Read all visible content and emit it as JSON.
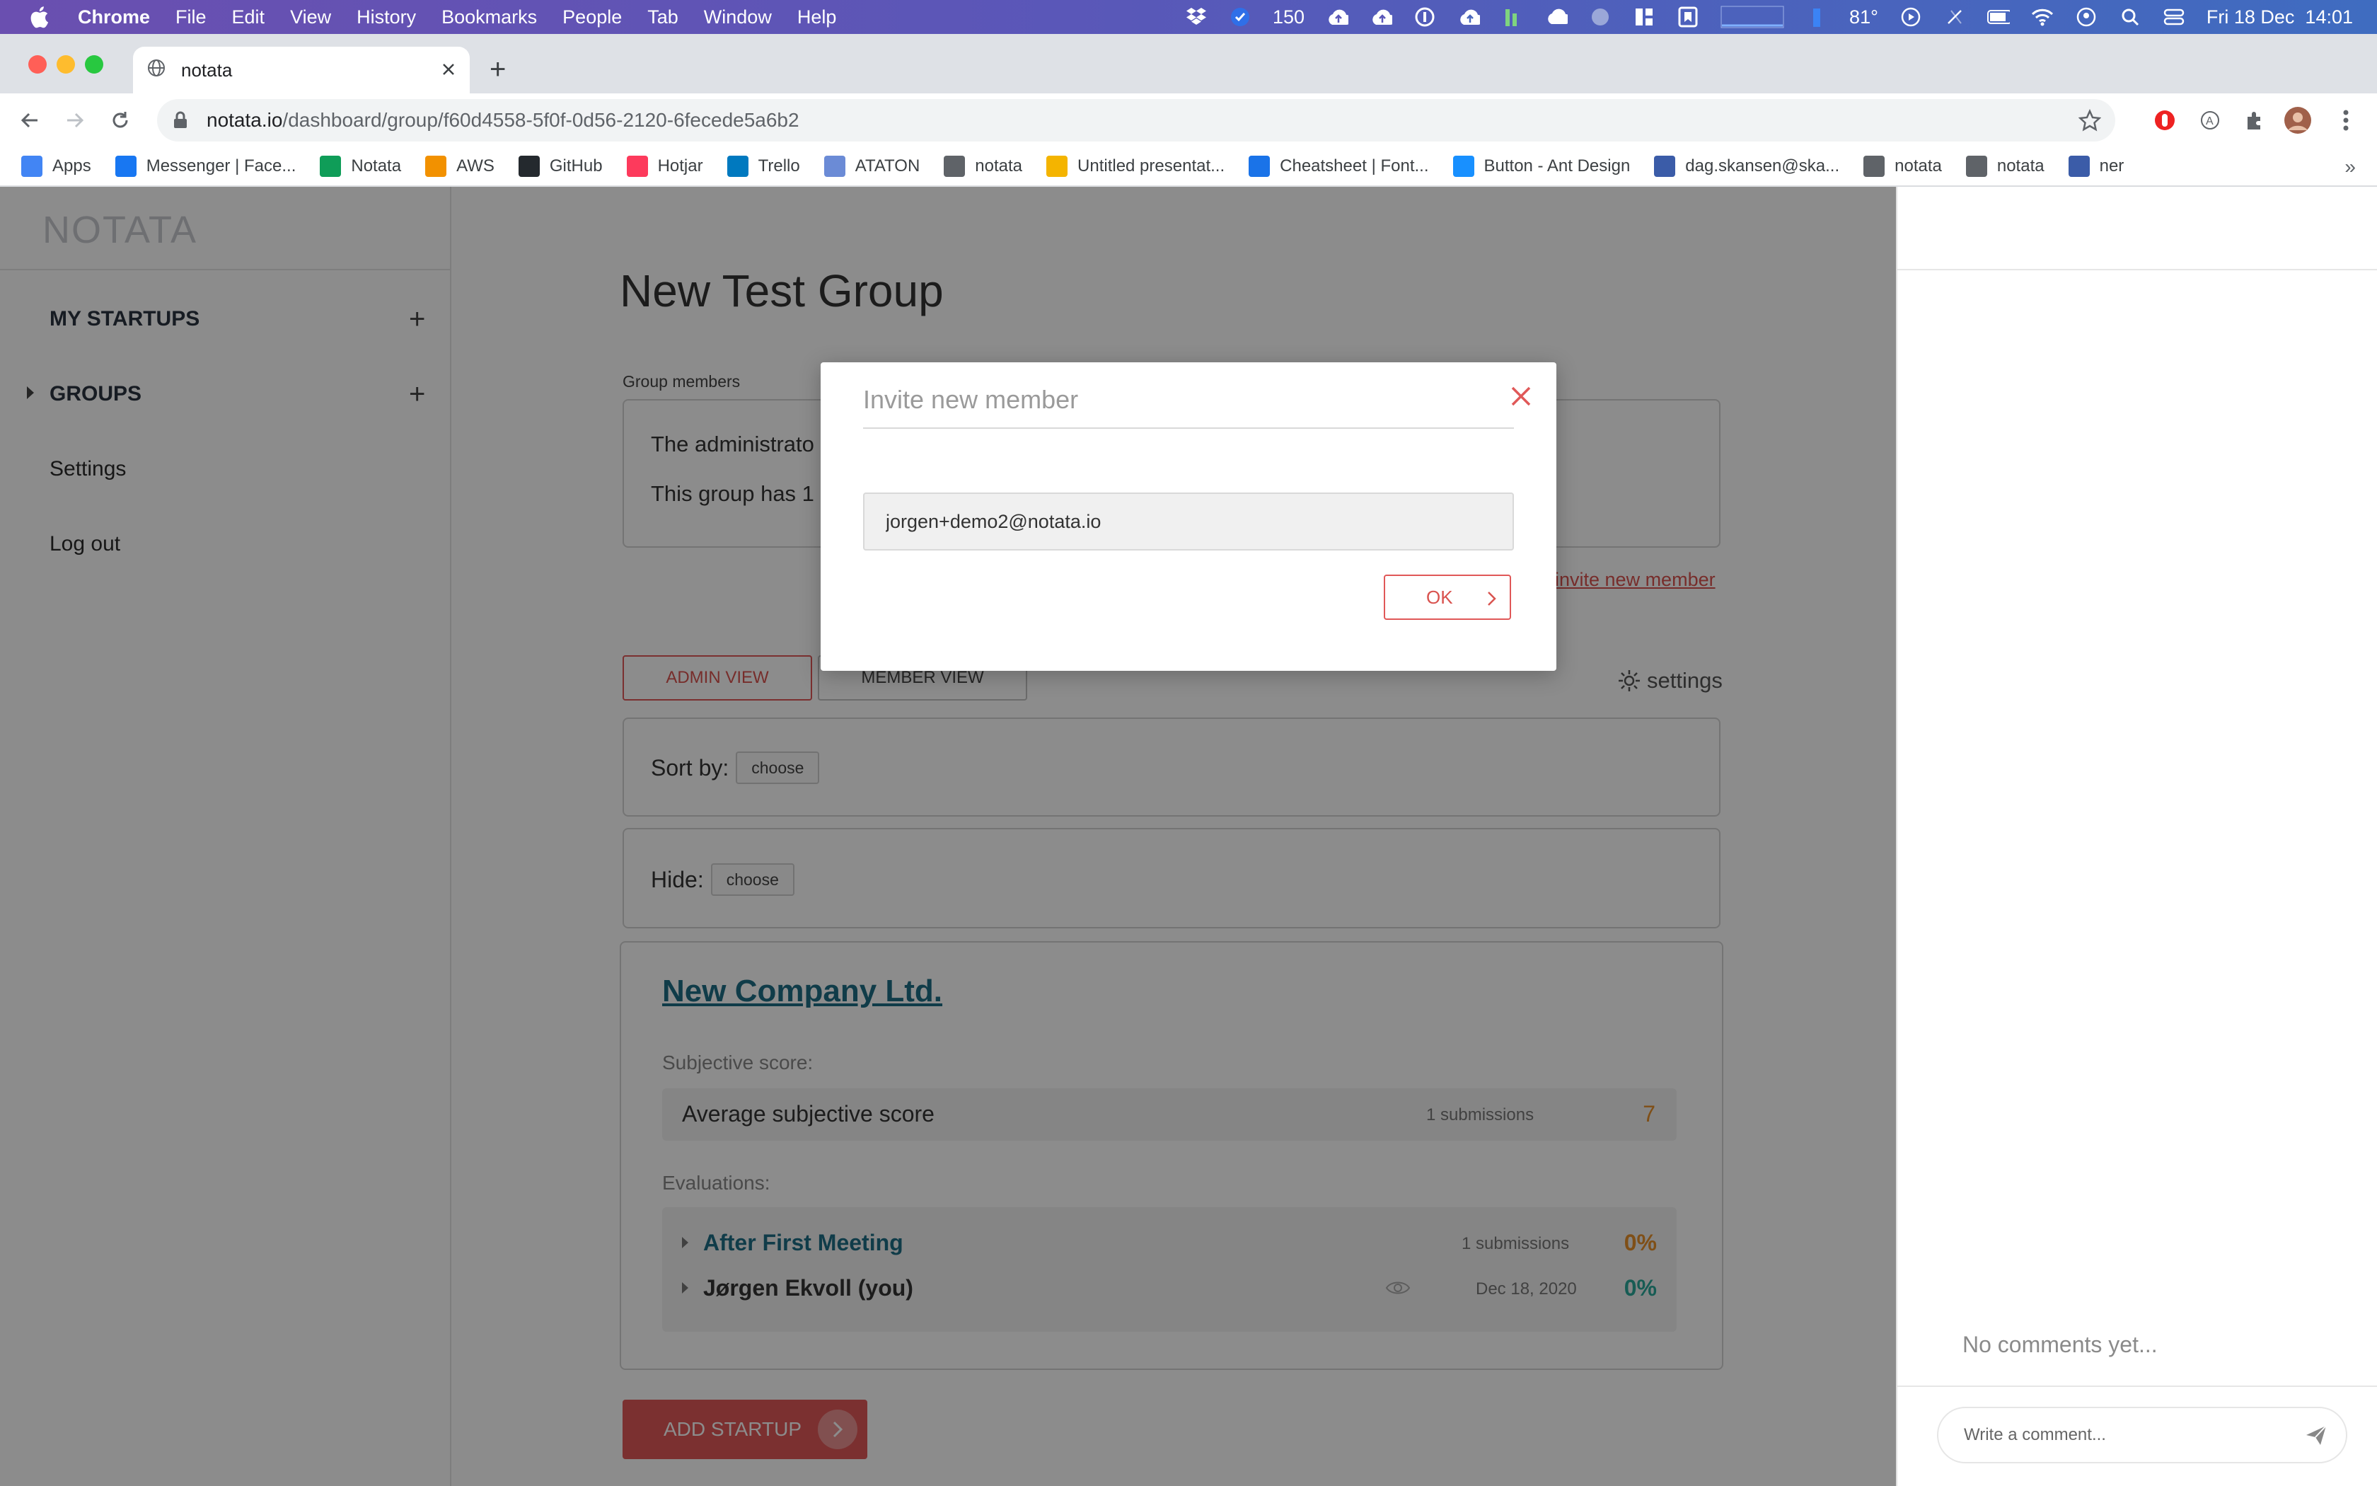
{
  "menubar": {
    "app_name": "Chrome",
    "menus": [
      "File",
      "Edit",
      "View",
      "History",
      "Bookmarks",
      "People",
      "Tab",
      "Window",
      "Help"
    ],
    "status_badge_count": "150",
    "temperature": "81°",
    "datetime": "Fri 18 Dec  14:01"
  },
  "browser": {
    "tab_title": "notata",
    "url_host": "notata.io",
    "url_path": "/dashboard/group/f60d4558-5f0f-0d56-2120-6fecede5a6b2",
    "bookmarks": [
      {
        "label": "Apps",
        "icon": "apps-grid-icon",
        "color": "#4285f4"
      },
      {
        "label": "Messenger | Face...",
        "icon": "facebook-icon",
        "color": "#1877f2"
      },
      {
        "label": "Notata",
        "icon": "drive-icon",
        "color": "#0f9d58"
      },
      {
        "label": "AWS",
        "icon": "aws-icon",
        "color": "#f29100"
      },
      {
        "label": "GitHub",
        "icon": "github-icon",
        "color": "#24292e"
      },
      {
        "label": "Hotjar",
        "icon": "hotjar-icon",
        "color": "#fd3a5c"
      },
      {
        "label": "Trello",
        "icon": "trello-icon",
        "color": "#0079bf"
      },
      {
        "label": "ATATON",
        "icon": "ataton-icon",
        "color": "#6b8bd6"
      },
      {
        "label": "notata",
        "icon": "globe-icon",
        "color": "#5f6368"
      },
      {
        "label": "Untitled presentat...",
        "icon": "slides-icon",
        "color": "#f4b400"
      },
      {
        "label": "Cheatsheet | Font...",
        "icon": "flag-icon",
        "color": "#1a73e8"
      },
      {
        "label": "Button - Ant Design",
        "icon": "antd-icon",
        "color": "#1890ff"
      },
      {
        "label": "dag.skansen@ska...",
        "icon": "database-icon",
        "color": "#3b5ca8"
      },
      {
        "label": "notata",
        "icon": "globe-icon",
        "color": "#5f6368"
      },
      {
        "label": "notata",
        "icon": "globe-icon",
        "color": "#5f6368"
      },
      {
        "label": "ner",
        "icon": "database-icon",
        "color": "#3b5ca8"
      }
    ],
    "bookmarks_overflow": "»"
  },
  "sidebar": {
    "logo": "NOTATA",
    "my_startups": "MY STARTUPS",
    "groups": "GROUPS",
    "settings": "Settings",
    "logout": "Log out"
  },
  "main": {
    "title": "New Test Group",
    "members_label": "Group members",
    "members_line1": "The administrato",
    "members_line2": "This group has 1",
    "invite_link": "invite new member",
    "admin_view": "ADMIN VIEW",
    "member_view": "MEMBER VIEW",
    "settings_link": "settings",
    "sort_by_label": "Sort by:",
    "sort_by_value": "choose",
    "hide_label": "Hide:",
    "hide_value": "choose",
    "company": {
      "name": "New Company Ltd.",
      "subjective_label": "Subjective score:",
      "avg_label": "Average subjective score",
      "avg_submissions": "1 submissions",
      "avg_value": "7",
      "evaluations_label": "Evaluations:",
      "evaluations": [
        {
          "name": "After First Meeting",
          "meta": "1 submissions",
          "pct": "0%",
          "name_color": "#1e6e86",
          "pct_color": "#e8912b"
        },
        {
          "name": "Jørgen Ekvoll (you)",
          "meta": "Dec 18, 2020",
          "pct": "0%",
          "name_color": "#333333",
          "pct_color": "#2ba89a"
        }
      ]
    },
    "add_startup": "ADD STARTUP"
  },
  "comments": {
    "empty_text": "No comments yet...",
    "input_placeholder": "Write a comment..."
  },
  "modal": {
    "title": "Invite new member",
    "input_value": "jorgen+demo2@notata.io",
    "ok_label": "OK"
  },
  "colors": {
    "accent_red": "#e05858",
    "teal_link": "#1e6e86",
    "orange_score": "#e8912b"
  }
}
